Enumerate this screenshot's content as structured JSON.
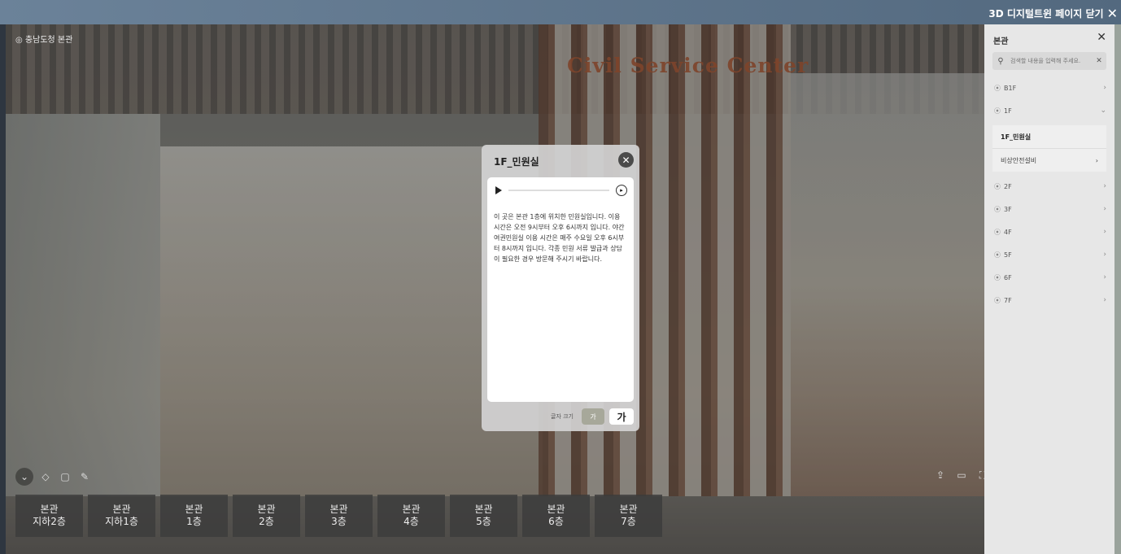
{
  "page": {
    "close_label": "3D 디지털트윈 페이지 닫기",
    "close_icon": "✕"
  },
  "viewer": {
    "location": "◎ 충남도청 본관",
    "sign": "Civil Service Center",
    "tools_left": [
      "⌄",
      "◇",
      "▢",
      "✎"
    ],
    "tools_right": [
      "⇪",
      "▭",
      "⛶"
    ]
  },
  "floor_buttons": [
    {
      "building": "본관",
      "floor": "지하2층"
    },
    {
      "building": "본관",
      "floor": "지하1층"
    },
    {
      "building": "본관",
      "floor": "1층"
    },
    {
      "building": "본관",
      "floor": "2층"
    },
    {
      "building": "본관",
      "floor": "3층"
    },
    {
      "building": "본관",
      "floor": "4층"
    },
    {
      "building": "본관",
      "floor": "5층"
    },
    {
      "building": "본관",
      "floor": "6층"
    },
    {
      "building": "본관",
      "floor": "7층"
    }
  ],
  "modal": {
    "title": "1F_민원실",
    "close_icon": "✕",
    "audio_progress": 0,
    "description": "이 곳은 본관 1층에 위치한 민원실입니다. 이용 시간은 오전 9시부터 오후 6시까지 입니다. 야간 여권민원실 이용 시간은 매주 수요일 오후 6시부터 8시까지 입니다. 각종 민원 서류 발급과 상담이 필요한 경우 방문해 주시기 바랍니다.",
    "font_size_label": "글자 크기",
    "font_small": "가",
    "font_large": "가"
  },
  "panel": {
    "title": "본관",
    "close_icon": "✕",
    "search_icon": "⚲",
    "search_placeholder": "검색할 내용을 입력해 주세요.",
    "search_clear": "✕",
    "floors": {
      "b1f": "B1F",
      "f1": "1F",
      "f2": "2F",
      "f3": "3F",
      "f4": "4F",
      "f5": "5F",
      "f6": "6F",
      "f7": "7F"
    },
    "sub": {
      "minwon": "1F_민원실",
      "safety": "비상안전설비"
    }
  }
}
